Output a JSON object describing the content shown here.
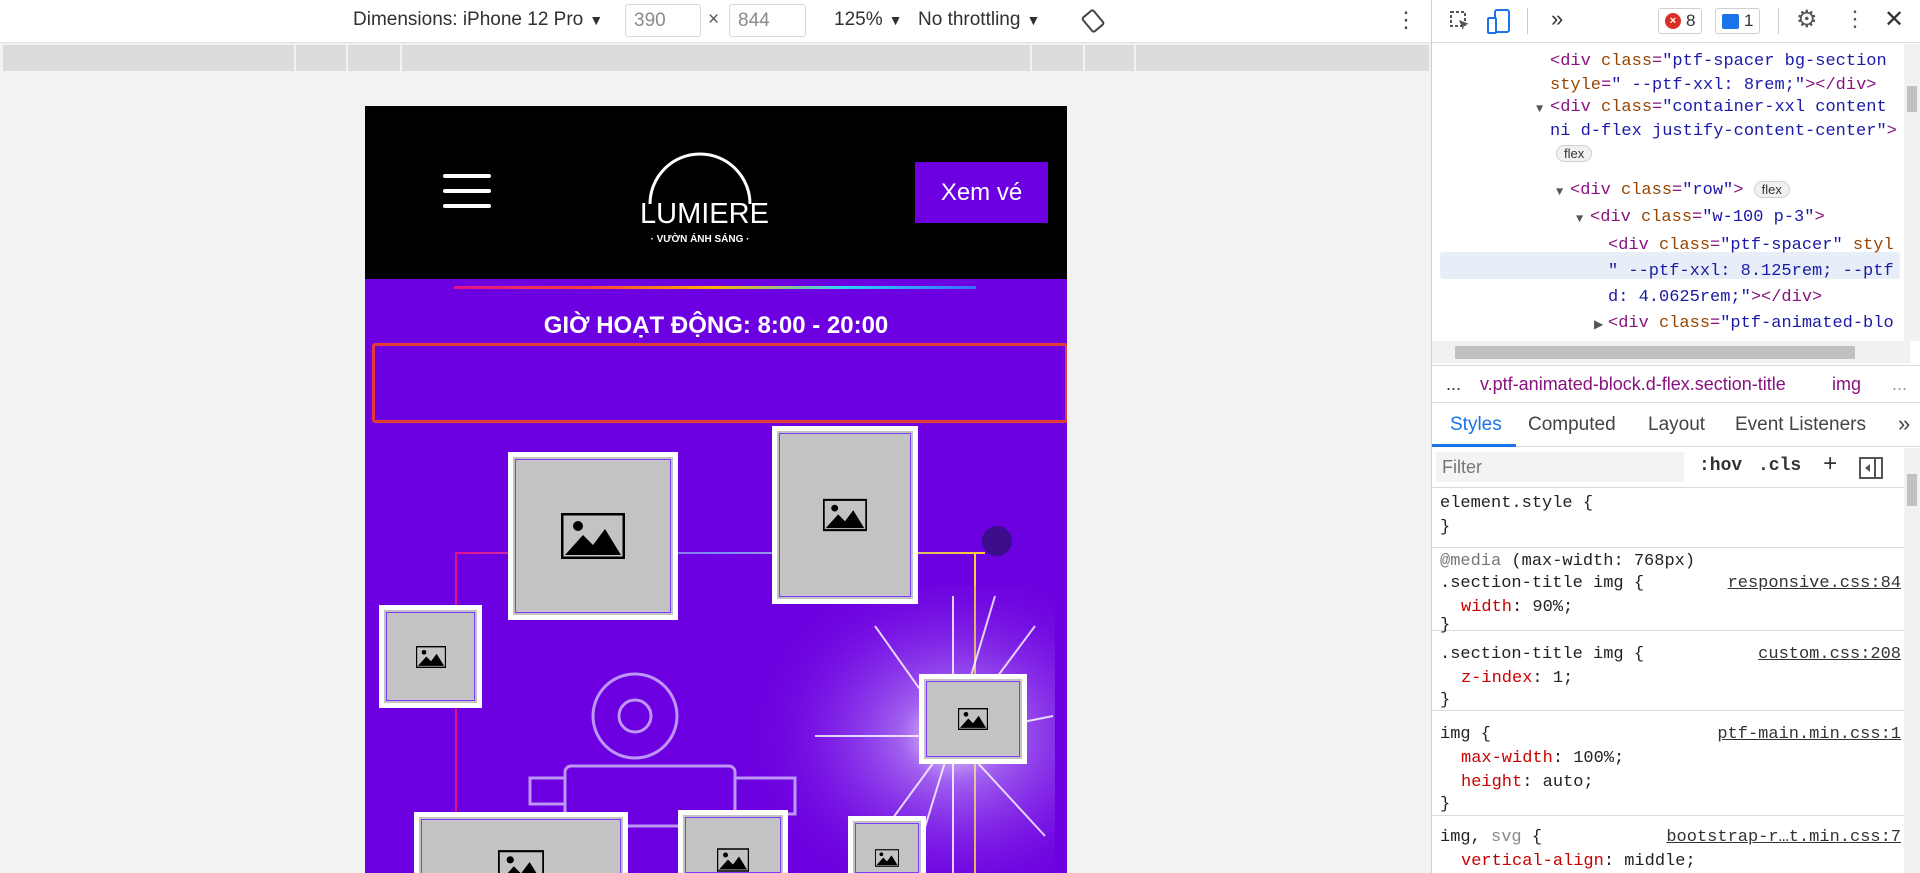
{
  "toolbar": {
    "dimensions_label": "Dimensions: iPhone 12 Pro",
    "width_value": "390",
    "height_value": "844",
    "times": "×",
    "zoom": "125%",
    "throttling": "No throttling",
    "more": "⋮"
  },
  "site": {
    "logo_word": "LUMIERE",
    "logo_sub": "· VƯỜN ÁNH SÁNG ·",
    "cta_label": "Xem vé",
    "hours": "GIỜ HOẠT ĐỘNG: 8:00 - 20:00"
  },
  "devtools": {
    "errors_count": "8",
    "messages_count": "1",
    "elements_lines": [
      {
        "tag_open": "<div ",
        "attr": "class",
        "val": "\"ptf-spacer bg-section",
        "rest": ""
      },
      {
        "tag_open": "",
        "attr": "style",
        "val": "\" --ptf-xxl: 8rem;\"",
        "rest": "></div>"
      },
      {
        "tag_open": "<div ",
        "attr": "class",
        "val": "\"container-xxl content",
        "rest": ""
      },
      {
        "tag_open": "",
        "attr": "",
        "val": "ni d-flex justify-content-center\"",
        "rest": ""
      },
      {
        "tag_open": "",
        "attr": "",
        "val": "",
        "rest": ""
      },
      {
        "tag_open": "<div ",
        "attr": "class",
        "val": "\"row\"",
        "rest": ">"
      },
      {
        "tag_open": "<div ",
        "attr": "class",
        "val": "\"w-100 p-3\"",
        "rest": ">"
      },
      {
        "tag_open": "<div ",
        "attr": "class",
        "val": "\"ptf-spacer\"",
        "rest": " styl"
      },
      {
        "tag_open": "",
        "attr": "",
        "val": "\" --ptf-xxl: 8.125rem; --ptf",
        "rest": ""
      },
      {
        "tag_open": "",
        "attr": "",
        "val": "d: 4.0625rem;\"",
        "rest": "></div>"
      },
      {
        "tag_open": "<div ",
        "attr": "class",
        "val": "\"ptf-animated-blo",
        "rest": ""
      }
    ],
    "flex_pill": "flex",
    "crumbs": {
      "ellipsis": "...",
      "path": "v.ptf-animated-block.d-flex.section-title",
      "last": "img",
      "more": "..."
    },
    "tabs": [
      "Styles",
      "Computed",
      "Layout",
      "Event Listeners"
    ],
    "tabs_more": "»",
    "filter_placeholder": "Filter",
    "hov": ":hov",
    "cls": ".cls",
    "plus": "+",
    "styles": {
      "element_style": "element.style {",
      "close": "}",
      "media_kw": "@media",
      "media_query": "(max-width: 768px)",
      "r1_selector": ".section-title img {",
      "r1_source": "responsive.css:84",
      "r1_prop": "width",
      "r1_val": "90%;",
      "r2_selector": ".section-title img {",
      "r2_source": "custom.css:208",
      "r2_prop": "z-index",
      "r2_val": "1;",
      "r3_selector": "img {",
      "r3_source": "ptf-main.min.css:1",
      "r3_prop1": "max-width",
      "r3_val1": "100%;",
      "r3_prop2": "height",
      "r3_val2": "auto;",
      "r4_selector_a": "img, ",
      "r4_selector_b": "svg",
      "r4_selector_c": " {",
      "r4_source": "bootstrap-r…t.min.css:7",
      "r4_prop": "vertical-align",
      "r4_val": "middle;"
    }
  },
  "colors": {
    "brand_purple": "#6c00e0",
    "highlight_red": "#e33a3a",
    "devtools_blue": "#1a73e8"
  }
}
